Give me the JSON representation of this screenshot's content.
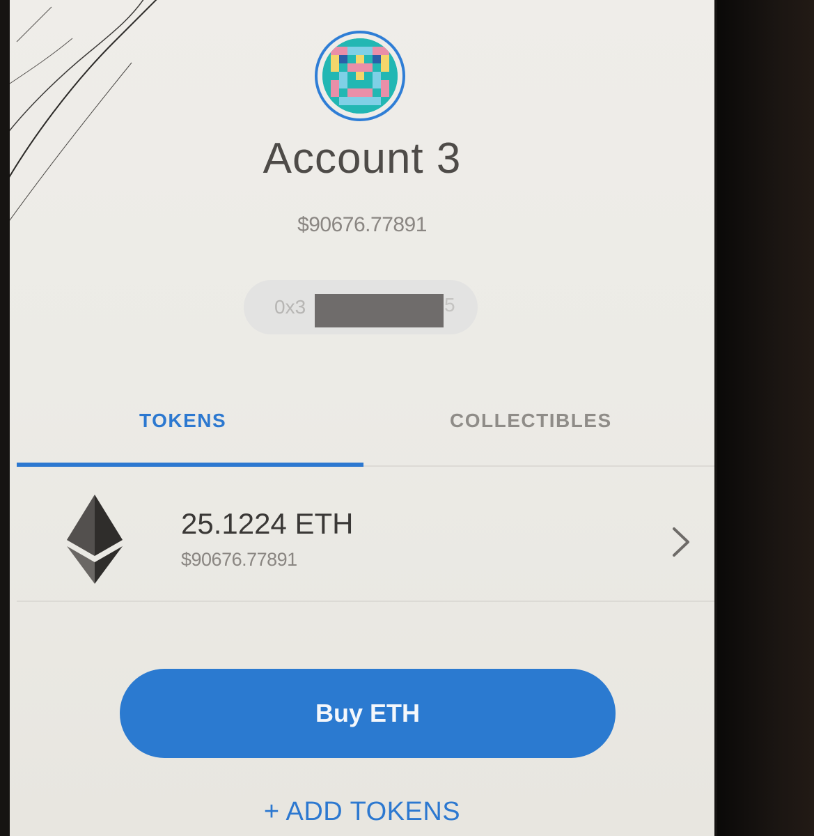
{
  "account": {
    "name": "Account 3",
    "balance_fiat": "$90676.77891",
    "address_prefix": "0x3",
    "address_suffix": "5"
  },
  "tabs": [
    {
      "label": "TOKENS",
      "active": true
    },
    {
      "label": "COLLECTIBLES",
      "active": false
    }
  ],
  "tokens": [
    {
      "amount": "25.1224 ETH",
      "fiat": "$90676.77891",
      "icon": "ethereum-icon"
    }
  ],
  "actions": {
    "buy_label": "Buy ETH",
    "add_tokens_label": "+ ADD TOKENS"
  },
  "colors": {
    "accent": "#2c78d0",
    "background": "#efede9",
    "text_primary": "#3a3836",
    "text_secondary": "#8a8682"
  },
  "icons": {
    "avatar": "identicon-avatar",
    "chevron": "chevron-right-icon",
    "token": "ethereum-icon"
  }
}
